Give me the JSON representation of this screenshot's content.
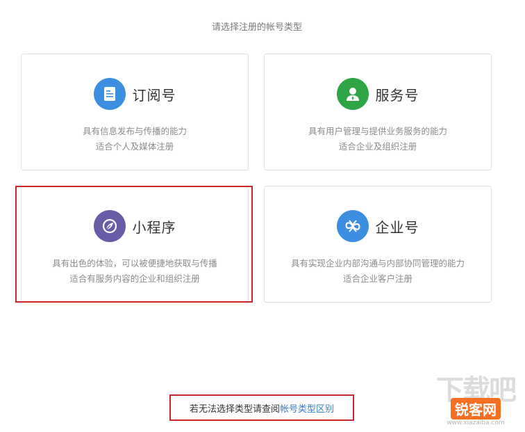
{
  "header": {
    "title": "请选择注册的帐号类型"
  },
  "cards": [
    {
      "name": "订阅号",
      "desc1": "具有信息发布与传播的能力",
      "desc2": "适合个人及媒体注册",
      "icon": "document-icon",
      "color": "#3b8ee0"
    },
    {
      "name": "服务号",
      "desc1": "具有用户管理与提供业务服务的能力",
      "desc2": "适合企业及组织注册",
      "icon": "user-icon",
      "color": "#2ea544"
    },
    {
      "name": "小程序",
      "desc1": "具有出色的体验，可以被便捷地获取与传播",
      "desc2": "适合有服务内容的企业和组织注册",
      "icon": "leaf-icon",
      "color": "#6a5ba8"
    },
    {
      "name": "企业号",
      "desc1": "具有实现企业内部沟通与内部协同管理的能力",
      "desc2": "适合企业客户注册",
      "icon": "infinity-icon",
      "color": "#3b8ee0"
    }
  ],
  "footer": {
    "text": "若无法选择类型请查阅",
    "link": "帐号类型区别"
  },
  "watermark": {
    "big": "下载吧",
    "logo": "锐客网",
    "url": "www.xiazaiba.com"
  },
  "colors": {
    "highlight": "#c8282c",
    "link": "#3a7ec8"
  }
}
